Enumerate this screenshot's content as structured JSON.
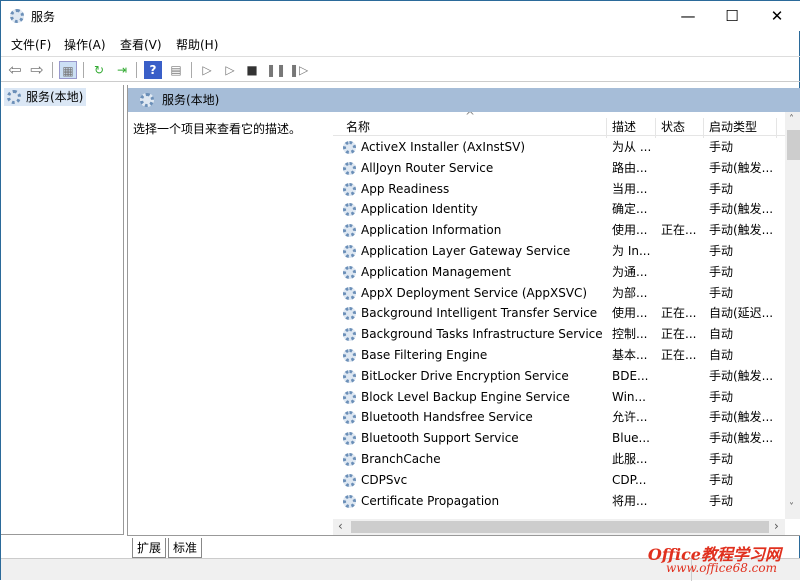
{
  "window": {
    "title": "服务",
    "minimize": "—",
    "maximize": "☐",
    "close": "✕"
  },
  "menu": [
    "文件(F)",
    "操作(A)",
    "查看(V)",
    "帮助(H)"
  ],
  "tree": {
    "root": "服务(本地)"
  },
  "panel": {
    "title": "服务(本地)",
    "description": "选择一个项目来查看它的描述。"
  },
  "columns": {
    "name": "名称",
    "desc": "描述",
    "status": "状态",
    "startup": "启动类型",
    "sort_indicator": "^"
  },
  "services": [
    {
      "name": "ActiveX Installer (AxInstSV)",
      "desc": "为从 ...",
      "status": "",
      "startup": "手动"
    },
    {
      "name": "AllJoyn Router Service",
      "desc": "路由...",
      "status": "",
      "startup": "手动(触发..."
    },
    {
      "name": "App Readiness",
      "desc": "当用...",
      "status": "",
      "startup": "手动"
    },
    {
      "name": "Application Identity",
      "desc": "确定...",
      "status": "",
      "startup": "手动(触发..."
    },
    {
      "name": "Application Information",
      "desc": "使用...",
      "status": "正在...",
      "startup": "手动(触发..."
    },
    {
      "name": "Application Layer Gateway Service",
      "desc": "为 In...",
      "status": "",
      "startup": "手动"
    },
    {
      "name": "Application Management",
      "desc": "为通...",
      "status": "",
      "startup": "手动"
    },
    {
      "name": "AppX Deployment Service (AppXSVC)",
      "desc": "为部...",
      "status": "",
      "startup": "手动"
    },
    {
      "name": "Background Intelligent Transfer Service",
      "desc": "使用...",
      "status": "正在...",
      "startup": "自动(延迟..."
    },
    {
      "name": "Background Tasks Infrastructure Service",
      "desc": "控制...",
      "status": "正在...",
      "startup": "自动"
    },
    {
      "name": "Base Filtering Engine",
      "desc": "基本...",
      "status": "正在...",
      "startup": "自动"
    },
    {
      "name": "BitLocker Drive Encryption Service",
      "desc": "BDE...",
      "status": "",
      "startup": "手动(触发..."
    },
    {
      "name": "Block Level Backup Engine Service",
      "desc": "Win...",
      "status": "",
      "startup": "手动"
    },
    {
      "name": "Bluetooth Handsfree Service",
      "desc": "允许...",
      "status": "",
      "startup": "手动(触发..."
    },
    {
      "name": "Bluetooth Support Service",
      "desc": "Blue...",
      "status": "",
      "startup": "手动(触发..."
    },
    {
      "name": "BranchCache",
      "desc": "此服...",
      "status": "",
      "startup": "手动"
    },
    {
      "name": "CDPSvc",
      "desc": "CDP...",
      "status": "",
      "startup": "手动"
    },
    {
      "name": "Certificate Propagation",
      "desc": "将用...",
      "status": "",
      "startup": "手动"
    }
  ],
  "tabs": [
    "扩展",
    "标准"
  ],
  "watermark": {
    "line1": "Office教程学习网",
    "line2": "www.office68.com"
  }
}
